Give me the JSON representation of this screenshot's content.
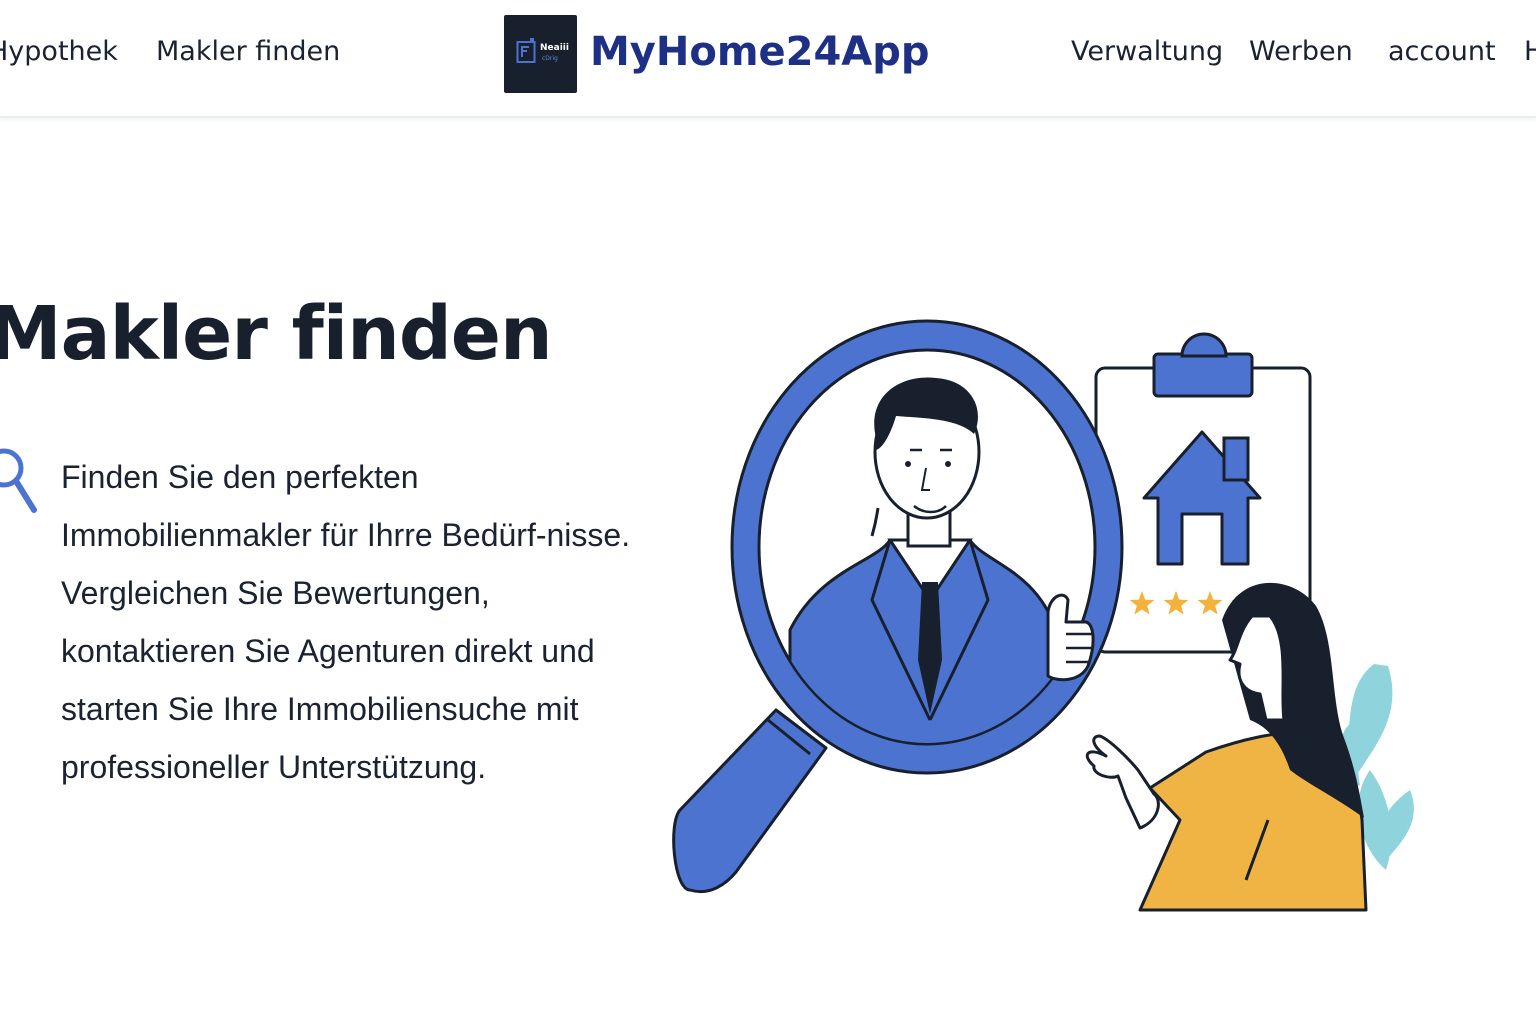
{
  "header": {
    "brand": "MyHome24App",
    "logo_text_top": "Neaiii",
    "logo_text_bottom": "cDrig",
    "nav_left": [
      {
        "label": "Hypothek"
      },
      {
        "label": "Makler finden"
      }
    ],
    "nav_right": [
      {
        "label": "Verwaltung"
      },
      {
        "label": "Werben"
      },
      {
        "label": "account"
      },
      {
        "label": "Hilfe"
      }
    ]
  },
  "hero": {
    "title": "Makler finden",
    "description": "Finden Sie den perfekten Immobilienmakler für Ihrre Bedürf-nisse. Vergleichen Sie Bewertungen, kontaktieren Sie Agenturen direkt und starten Sie Ihre Immobiliensuche mit professioneller Unterstützung.",
    "rating_stars": 4
  },
  "colors": {
    "brand": "#1e2f86",
    "accent_blue": "#4d73d1",
    "dark": "#18202d",
    "yellow": "#f0b445",
    "leaf": "#8fd3dc",
    "star": "#f2b33d"
  }
}
